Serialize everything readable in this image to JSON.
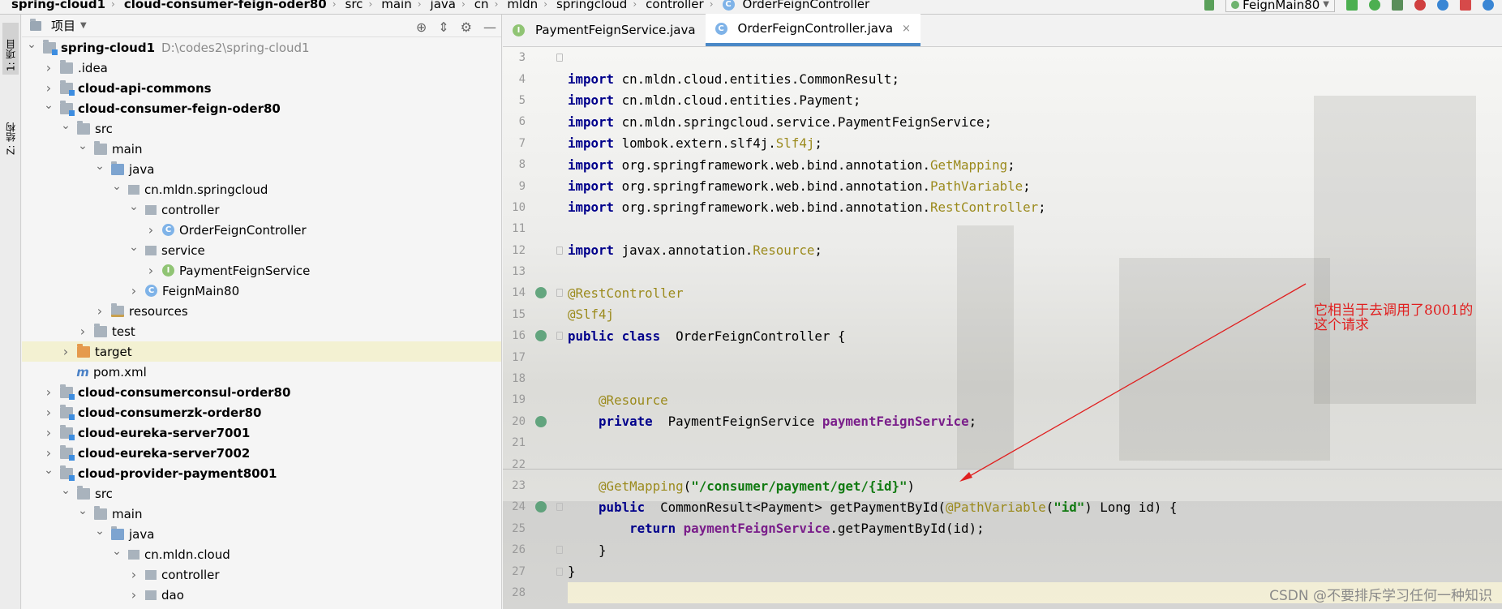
{
  "breadcrumb": [
    "spring-cloud1",
    "cloud-consumer-feign-oder80",
    "src",
    "main",
    "java",
    "cn",
    "mldn",
    "springcloud",
    "controller",
    "OrderFeignController"
  ],
  "run_config": "FeignMain80",
  "side_tabs": {
    "project": "1: 项目",
    "structure": "Z: 结构"
  },
  "project_panel": {
    "title": "项目"
  },
  "tree": [
    {
      "name": "spring-cloud1",
      "path": "D:\\codes2\\spring-cloud1",
      "depth": 0,
      "arrow": "open",
      "icon": "modfolder",
      "bold": true
    },
    {
      "name": ".idea",
      "depth": 1,
      "arrow": "closed",
      "icon": "folder"
    },
    {
      "name": "cloud-api-commons",
      "depth": 1,
      "arrow": "closed",
      "icon": "modfolder",
      "bold": true
    },
    {
      "name": "cloud-consumer-feign-oder80",
      "depth": 1,
      "arrow": "open",
      "icon": "modfolder",
      "bold": true
    },
    {
      "name": "src",
      "depth": 2,
      "arrow": "open",
      "icon": "folder"
    },
    {
      "name": "main",
      "depth": 3,
      "arrow": "open",
      "icon": "folder"
    },
    {
      "name": "java",
      "depth": 4,
      "arrow": "open",
      "icon": "srcfolder"
    },
    {
      "name": "cn.mldn.springcloud",
      "depth": 5,
      "arrow": "open",
      "icon": "pkg"
    },
    {
      "name": "controller",
      "depth": 6,
      "arrow": "open",
      "icon": "pkg"
    },
    {
      "name": "OrderFeignController",
      "depth": 7,
      "arrow": "closed",
      "icon": "cls"
    },
    {
      "name": "service",
      "depth": 6,
      "arrow": "open",
      "icon": "pkg"
    },
    {
      "name": "PaymentFeignService",
      "depth": 7,
      "arrow": "closed",
      "icon": "itf"
    },
    {
      "name": "FeignMain80",
      "depth": 6,
      "arrow": "closed",
      "icon": "cls"
    },
    {
      "name": "resources",
      "depth": 4,
      "arrow": "closed",
      "icon": "resfolder"
    },
    {
      "name": "test",
      "depth": 3,
      "arrow": "closed",
      "icon": "folder"
    },
    {
      "name": "target",
      "depth": 2,
      "arrow": "closed",
      "icon": "tgtfolder",
      "highlight": true
    },
    {
      "name": "pom.xml",
      "depth": 2,
      "arrow": "none",
      "icon": "mvn"
    },
    {
      "name": "cloud-consumerconsul-order80",
      "depth": 1,
      "arrow": "closed",
      "icon": "modfolder",
      "bold": true
    },
    {
      "name": "cloud-consumerzk-order80",
      "depth": 1,
      "arrow": "closed",
      "icon": "modfolder",
      "bold": true
    },
    {
      "name": "cloud-eureka-server7001",
      "depth": 1,
      "arrow": "closed",
      "icon": "modfolder",
      "bold": true
    },
    {
      "name": "cloud-eureka-server7002",
      "depth": 1,
      "arrow": "closed",
      "icon": "modfolder",
      "bold": true
    },
    {
      "name": "cloud-provider-payment8001",
      "depth": 1,
      "arrow": "open",
      "icon": "modfolder",
      "bold": true
    },
    {
      "name": "src",
      "depth": 2,
      "arrow": "open",
      "icon": "folder"
    },
    {
      "name": "main",
      "depth": 3,
      "arrow": "open",
      "icon": "folder"
    },
    {
      "name": "java",
      "depth": 4,
      "arrow": "open",
      "icon": "srcfolder"
    },
    {
      "name": "cn.mldn.cloud",
      "depth": 5,
      "arrow": "open",
      "icon": "pkg"
    },
    {
      "name": "controller",
      "depth": 6,
      "arrow": "closed",
      "icon": "pkg"
    },
    {
      "name": "dao",
      "depth": 6,
      "arrow": "closed",
      "icon": "pkg"
    }
  ],
  "tabs": [
    {
      "label": "PaymentFeignService.java",
      "icon": "I",
      "active": false
    },
    {
      "label": "OrderFeignController.java",
      "icon": "C",
      "active": true
    }
  ],
  "code_lines": [
    {
      "n": "3",
      "tokens": []
    },
    {
      "n": "4",
      "tokens": [
        [
          "kw",
          "import"
        ],
        [
          "",
          "cn.mldn.cloud.entities.CommonResult;"
        ]
      ]
    },
    {
      "n": "5",
      "tokens": [
        [
          "kw",
          "import"
        ],
        [
          "",
          "cn.mldn.cloud.entities.Payment;"
        ]
      ]
    },
    {
      "n": "6",
      "tokens": [
        [
          "kw",
          "import"
        ],
        [
          "",
          "cn.mldn.springcloud.service.PaymentFeignService;"
        ]
      ]
    },
    {
      "n": "7",
      "tokens": [
        [
          "kw",
          "import"
        ],
        [
          "",
          "lombok.extern.slf4j."
        ],
        [
          "an",
          "Slf4j"
        ],
        [
          "",
          ";"
        ]
      ]
    },
    {
      "n": "8",
      "tokens": [
        [
          "kw",
          "import"
        ],
        [
          "",
          "org.springframework.web.bind.annotation."
        ],
        [
          "an",
          "GetMapping"
        ],
        [
          "",
          ";"
        ]
      ]
    },
    {
      "n": "9",
      "tokens": [
        [
          "kw",
          "import"
        ],
        [
          "",
          "org.springframework.web.bind.annotation."
        ],
        [
          "an",
          "PathVariable"
        ],
        [
          "",
          ";"
        ]
      ]
    },
    {
      "n": "10",
      "tokens": [
        [
          "kw",
          "import"
        ],
        [
          "",
          "org.springframework.web.bind.annotation."
        ],
        [
          "an",
          "RestController"
        ],
        [
          "",
          ";"
        ]
      ]
    },
    {
      "n": "11",
      "tokens": []
    },
    {
      "n": "12",
      "tokens": [
        [
          "kw",
          "import"
        ],
        [
          "",
          "javax.annotation."
        ],
        [
          "an",
          "Resource"
        ],
        [
          "",
          ";"
        ]
      ]
    },
    {
      "n": "13",
      "tokens": []
    },
    {
      "n": "14",
      "tokens": [
        [
          "an",
          "@RestController"
        ]
      ]
    },
    {
      "n": "15",
      "tokens": [
        [
          "an",
          "@Slf4j"
        ]
      ]
    },
    {
      "n": "16",
      "tokens": [
        [
          "kw",
          "public class"
        ],
        [
          "",
          " OrderFeignController {"
        ]
      ]
    },
    {
      "n": "17",
      "tokens": []
    },
    {
      "n": "18",
      "tokens": []
    },
    {
      "n": "19",
      "tokens": [
        [
          "",
          "    "
        ],
        [
          "an",
          "@Resource"
        ]
      ]
    },
    {
      "n": "20",
      "tokens": [
        [
          "",
          "    "
        ],
        [
          "kw",
          "private"
        ],
        [
          "",
          " PaymentFeignService "
        ],
        [
          "fld",
          "paymentFeignService"
        ],
        [
          "",
          ";"
        ]
      ]
    },
    {
      "n": "21",
      "tokens": []
    },
    {
      "n": "22",
      "tokens": []
    },
    {
      "n": "23",
      "tokens": [
        [
          "",
          "    "
        ],
        [
          "an",
          "@GetMapping"
        ],
        [
          "",
          "("
        ],
        [
          "str",
          "\"/consumer/payment/get/{id}\""
        ],
        [
          "",
          ")"
        ]
      ]
    },
    {
      "n": "24",
      "tokens": [
        [
          "",
          "    "
        ],
        [
          "kw",
          "public"
        ],
        [
          "",
          " CommonResult<Payment> getPaymentById("
        ],
        [
          "an",
          "@PathVariable"
        ],
        [
          "",
          "("
        ],
        [
          "str",
          "\"id\""
        ],
        [
          "",
          ") Long id) {"
        ]
      ]
    },
    {
      "n": "25",
      "tokens": [
        [
          "",
          "        "
        ],
        [
          "kw",
          "return"
        ],
        [
          " ",
          ""
        ],
        [
          "fld",
          "paymentFeignService"
        ],
        [
          "",
          ".getPaymentById(id);"
        ]
      ]
    },
    {
      "n": "26",
      "tokens": [
        [
          "",
          "    }"
        ]
      ]
    },
    {
      "n": "27",
      "tokens": [
        [
          "",
          "}"
        ]
      ]
    },
    {
      "n": "28",
      "tokens": []
    }
  ],
  "annotation": {
    "line1": "它相当于去调用了8001的",
    "line2": "这个请求",
    "color": "#e02020"
  },
  "watermark": "CSDN @不要排斥学习任何一种知识"
}
